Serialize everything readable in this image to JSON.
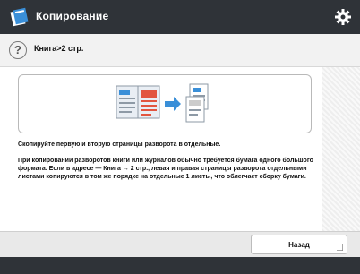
{
  "header": {
    "title": "Копирование",
    "app_icon": "copy-app-icon",
    "settings_icon": "gear-icon"
  },
  "subheader": {
    "help_icon": "question-icon",
    "help_glyph": "?",
    "mode_label": "Книга>2 стр."
  },
  "content": {
    "illustration_icon": "book-to-pages-icon",
    "message_1": "Скопируйте первую и вторую страницы разворота в отдельные.",
    "message_2": "При копировании разворотов книги или журналов обычно требуется бумага одного большого формата. Если в адресе — Книга → 2 стр., левая и правая страницы разворота отдельными листами копируются в том же порядке на отдельные 1 листы, что облегчает сборку бумаги."
  },
  "footer_bar": {
    "back_label": "Назад"
  },
  "colors": {
    "header_bg": "#2f3338",
    "accent_blue": "#3a8fd8",
    "accent_red": "#e2553f"
  }
}
